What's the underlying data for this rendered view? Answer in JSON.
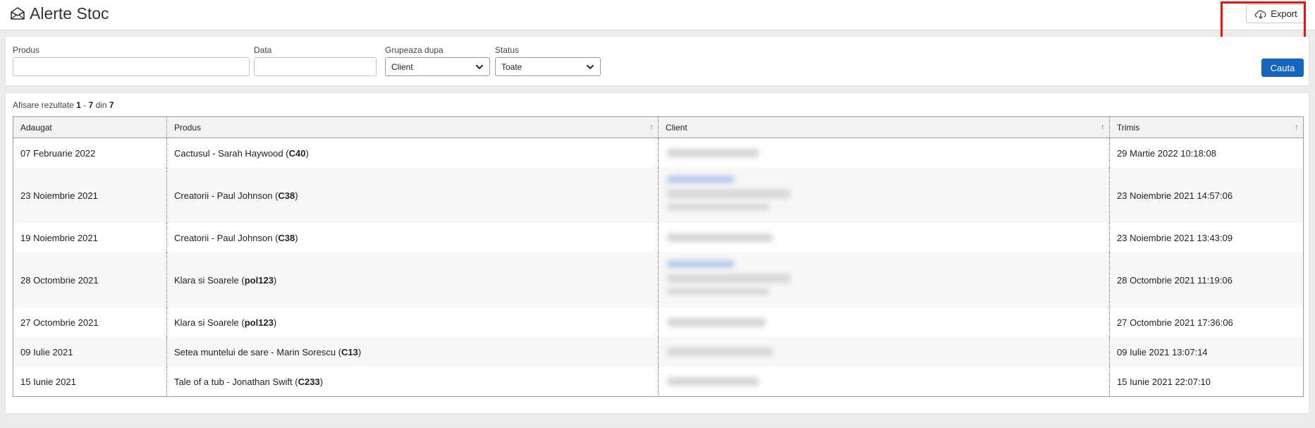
{
  "header": {
    "title": "Alerte Stoc",
    "export_label": "Export"
  },
  "filters": {
    "produs_label": "Produs",
    "produs_value": "",
    "data_label": "Data",
    "data_value": "",
    "grupare_label": "Grupeaza dupa",
    "grupare_selected": "Client",
    "status_label": "Status",
    "status_selected": "Toate",
    "search_label": "Cauta"
  },
  "results": {
    "prefix": "Afisare rezultate",
    "from": "1",
    "dash": "-",
    "to": "7",
    "of_word": "din",
    "total": "7"
  },
  "table": {
    "columns": [
      "Adaugat",
      "Produs",
      "Client",
      "Trimis"
    ],
    "sort_icon": "↑",
    "rows": [
      {
        "added": "07 Februarie 2022",
        "product": "Cactusul - Sarah Haywood",
        "code": "C40",
        "sent": "29 Martie 2022 10:18:08",
        "client_lines": 1
      },
      {
        "added": "23 Noiembrie 2021",
        "product": "Creatorii - Paul Johnson",
        "code": "C38",
        "sent": "23 Noiembrie 2021 14:57:06",
        "client_lines": 3
      },
      {
        "added": "19 Noiembrie 2021",
        "product": "Creatorii - Paul Johnson",
        "code": "C38",
        "sent": "23 Noiembrie 2021 13:43:09",
        "client_lines": 1
      },
      {
        "added": "28 Octombrie 2021",
        "product": "Klara si Soarele",
        "code": "pol123",
        "sent": "28 Octombrie 2021 11:19:06",
        "client_lines": 3
      },
      {
        "added": "27 Octombrie 2021",
        "product": "Klara si Soarele",
        "code": "pol123",
        "sent": "27 Octombrie 2021 17:36:06",
        "client_lines": 1
      },
      {
        "added": "09 Iulie 2021",
        "product": "Setea muntelui de sare - Marin Sorescu",
        "code": "C13",
        "sent": "09 Iulie 2021 13:07:14",
        "client_lines": 1
      },
      {
        "added": "15 Iunie 2021",
        "product": "Tale of a tub - Jonathan Swift",
        "code": "C233",
        "sent": "15 Iunie 2021 22:07:10",
        "client_lines": 1
      }
    ]
  },
  "colors": {
    "primary_button": "#1565c0",
    "highlight_box": "#ee1111"
  },
  "icons": {
    "title_icon": "envelope-open-icon",
    "export_icon": "cloud-download-icon",
    "dropdown_icon": "chevron-down-icon"
  }
}
